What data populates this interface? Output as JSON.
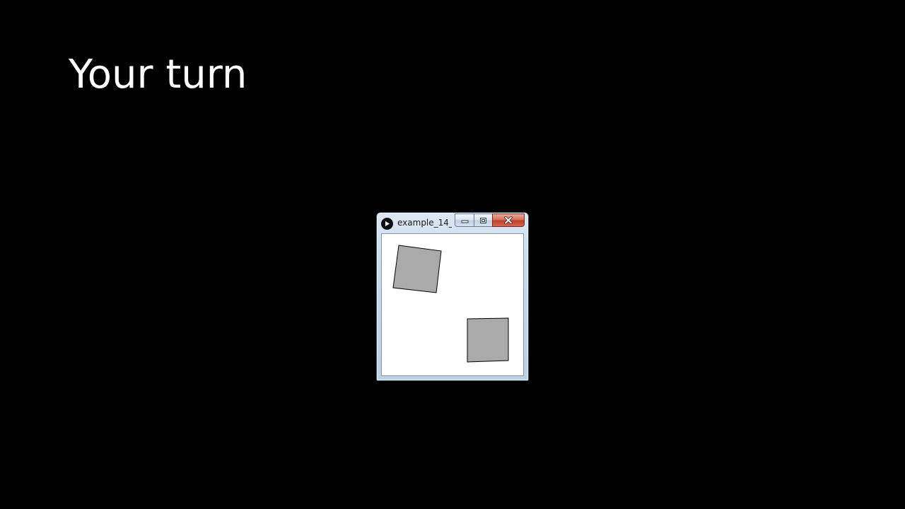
{
  "slide": {
    "title": "Your turn"
  },
  "window": {
    "title": "example_14_...",
    "app_icon": "play-circle-icon",
    "buttons": {
      "minimize_icon": "minimize-icon",
      "maximize_icon": "maximize-icon",
      "close_icon": "close-icon"
    }
  },
  "colors": {
    "background": "#000000",
    "title_text": "#ffffff",
    "canvas_background": "#ffffff",
    "square_fill": "#aaaaaa",
    "square_stroke": "#000000",
    "close_button": "#c7422c"
  }
}
